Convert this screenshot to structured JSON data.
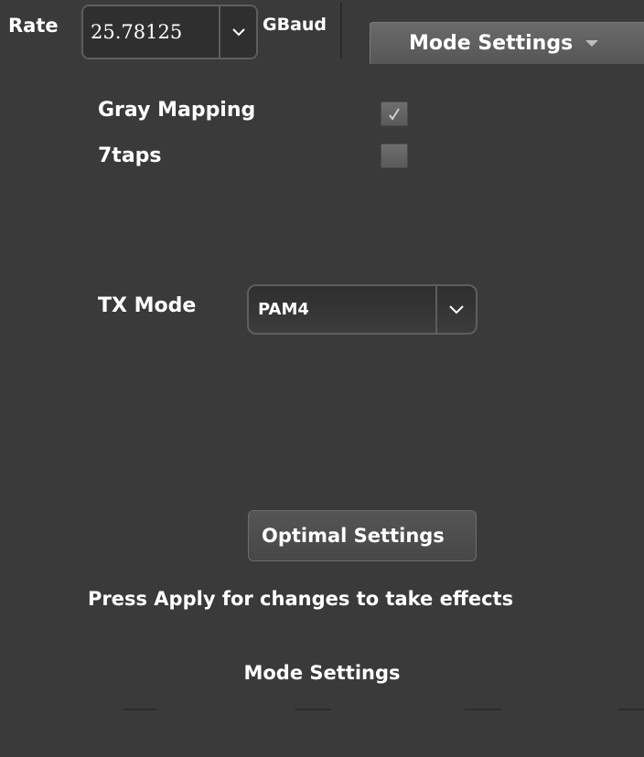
{
  "header": {
    "rate_label": "Rate",
    "rate_value": "25.78125",
    "rate_unit": "GBaud",
    "tab_label": "Mode Settings"
  },
  "options": [
    {
      "label": "Gray Mapping",
      "checked": true
    },
    {
      "label": "7taps",
      "checked": false
    }
  ],
  "tx_mode": {
    "label": "TX Mode",
    "value": "PAM4"
  },
  "optimal_button": "Optimal Settings",
  "message": "Press Apply for changes to take effects",
  "footer_title": "Mode Settings",
  "colors": {
    "background": "#3a3a3a",
    "text": "#ffffff",
    "tab": "#5e5e5e"
  },
  "icons": [
    "chevron-down-icon",
    "triangle-down-icon",
    "checkmark-icon"
  ]
}
